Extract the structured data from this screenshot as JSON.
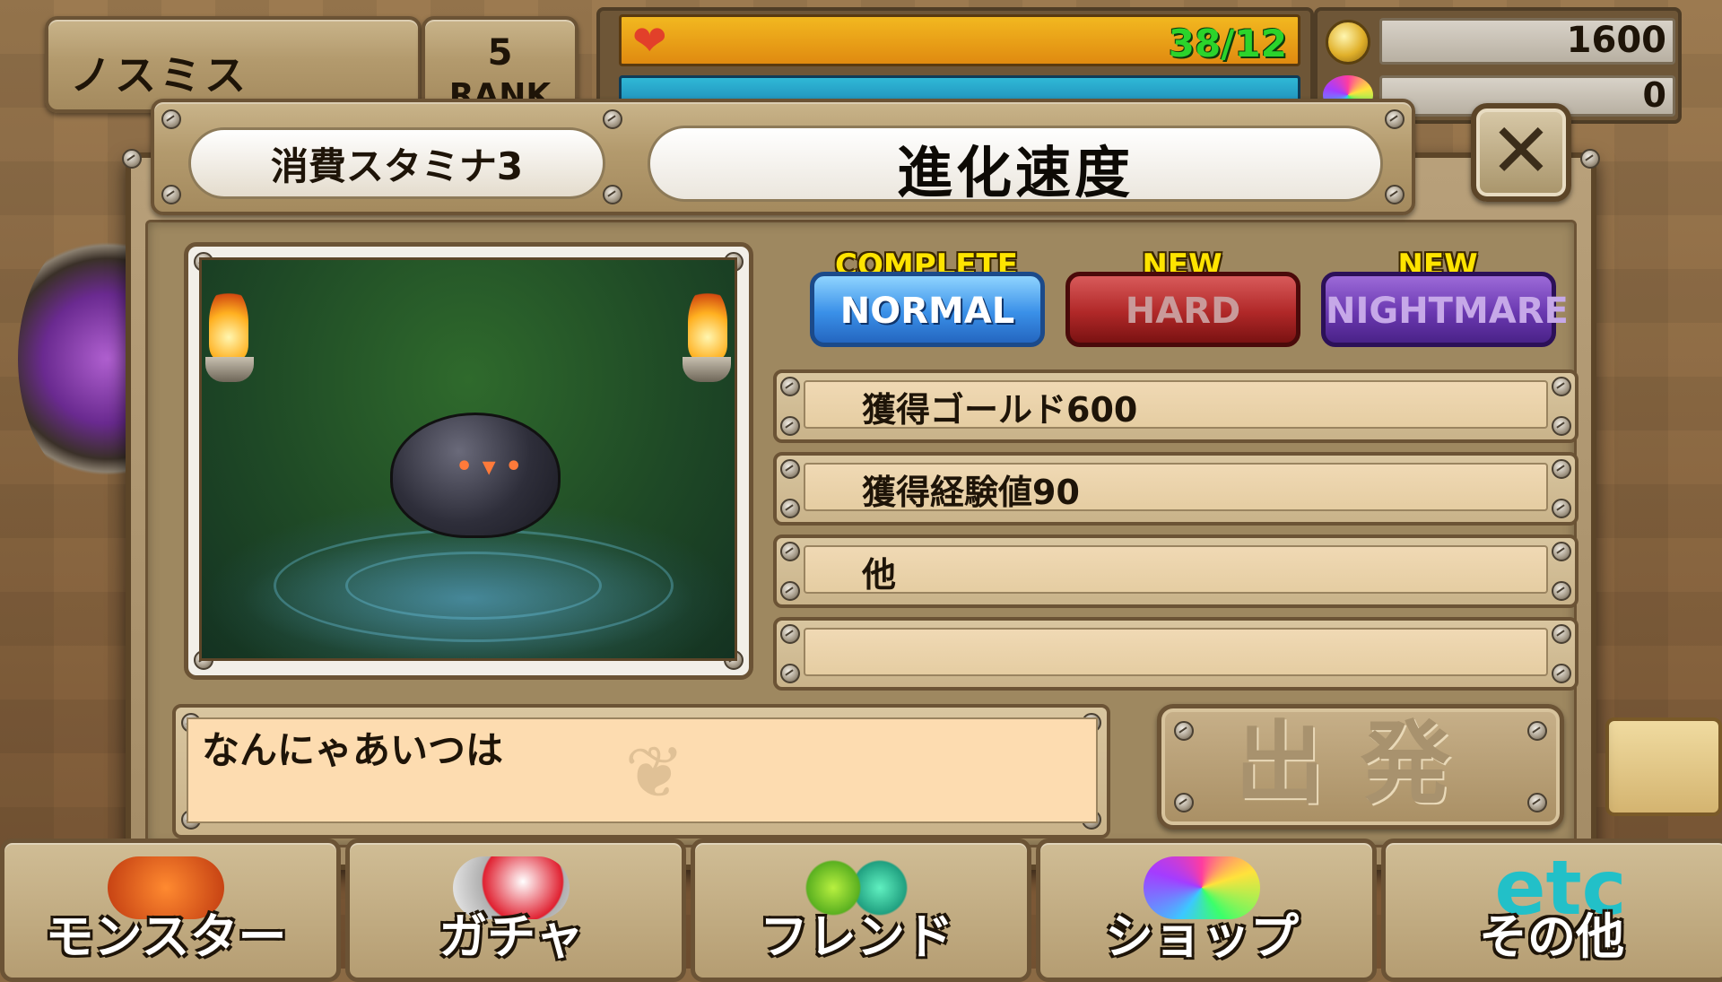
{
  "header": {
    "player_name": "ノスミス",
    "rank_value": "5",
    "rank_label": "RANK",
    "stamina_text": "38/12",
    "gold_value": "1600",
    "gem_value": "0"
  },
  "dialog": {
    "stamina_cost": "消費スタミナ3",
    "stage_title": "進化速度",
    "close_icon": "close-icon",
    "difficulty": {
      "normal": {
        "badge": "COMPLETE",
        "label": "NORMAL"
      },
      "hard": {
        "badge": "NEW",
        "label": "HARD"
      },
      "nightmare": {
        "badge": "NEW",
        "label": "NIGHTMARE"
      }
    },
    "rewards": [
      "獲得ゴールド600",
      "獲得経験値90",
      "他",
      ""
    ],
    "description": "なんにゃあいつは",
    "depart_label": "出発"
  },
  "bottom_nav": {
    "items": [
      {
        "label": "モンスター",
        "icon": "dragon-icon"
      },
      {
        "label": "ガチャ",
        "icon": "gacha-ball-icon"
      },
      {
        "label": "フレンド",
        "icon": "friend-orbs-icon"
      },
      {
        "label": "ショップ",
        "icon": "gem-shop-icon"
      },
      {
        "label": "その他",
        "icon": "etc-icon"
      }
    ]
  },
  "colors": {
    "normal_tab": "#3a90e8",
    "hard_tab": "#b02828",
    "nightmare_tab": "#6a38b0",
    "badge_yellow": "#ffe400",
    "stamina_text": "#2bd42b"
  }
}
